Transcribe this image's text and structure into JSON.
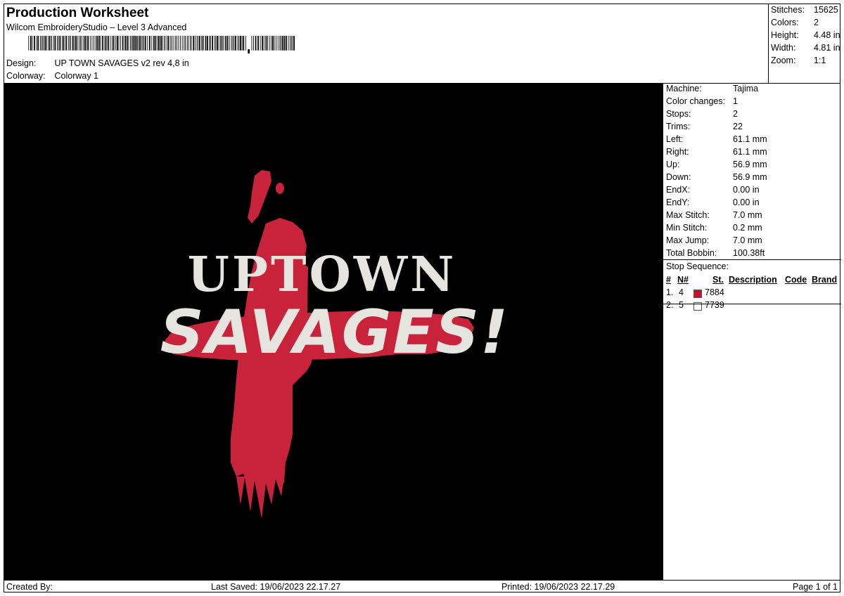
{
  "header": {
    "title": "Production Worksheet",
    "software": "Wilcom EmbroideryStudio – Level 3 Advanced",
    "design_label": "Design:",
    "design_value": "UP TOWN SAVAGES v2 rev 4,8 in",
    "colorway_label": "Colorway:",
    "colorway_value": "Colorway 1"
  },
  "summary": {
    "stitches_label": "Stitches:",
    "stitches": "15625",
    "colors_label": "Colors:",
    "colors": "2",
    "height_label": "Height:",
    "height": "4.48 in",
    "width_label": "Width:",
    "width": "4.81 in",
    "zoom_label": "Zoom:",
    "zoom": "1:1"
  },
  "machine_info": [
    {
      "label": "Machine:",
      "value": "Tajima"
    },
    {
      "label": "Color changes:",
      "value": "1"
    },
    {
      "label": "Stops:",
      "value": "2"
    },
    {
      "label": "Trims:",
      "value": "22"
    },
    {
      "label": "Left:",
      "value": "61.1 mm"
    },
    {
      "label": "Right:",
      "value": "61.1 mm"
    },
    {
      "label": "Up:",
      "value": "56.9 mm"
    },
    {
      "label": "Down:",
      "value": "56.9 mm"
    },
    {
      "label": "EndX:",
      "value": "0.00 in"
    },
    {
      "label": "EndY:",
      "value": "0.00 in"
    },
    {
      "label": "Max Stitch:",
      "value": "7.0 mm"
    },
    {
      "label": "Min Stitch:",
      "value": "0.2 mm"
    },
    {
      "label": "Max Jump:",
      "value": "7.0 mm"
    },
    {
      "label": "Total Bobbin:",
      "value": "100.38ft"
    }
  ],
  "stop_sequence": {
    "title": "Stop Sequence:",
    "headers": {
      "num": "#",
      "needle": "N#",
      "st": "St.",
      "description": "Description",
      "code": "Code",
      "brand": "Brand"
    },
    "rows": [
      {
        "num": "1.",
        "needle": "4",
        "swatch": "#c8102e",
        "st": "7884"
      },
      {
        "num": "2.",
        "needle": "5",
        "swatch": "#ffffff",
        "st": "7739"
      }
    ]
  },
  "design_text": {
    "line1": "UPTOWN",
    "line2": "SAVAGES!"
  },
  "colors": {
    "thread_red": "#c8233a",
    "thread_white": "#e6e4de",
    "background": "#000000"
  },
  "footer": {
    "created_by": "Created By:",
    "last_saved": "Last Saved: 19/06/2023 22.17.27",
    "printed": "Printed: 19/06/2023 22.17.29",
    "page": "Page 1 of 1"
  }
}
